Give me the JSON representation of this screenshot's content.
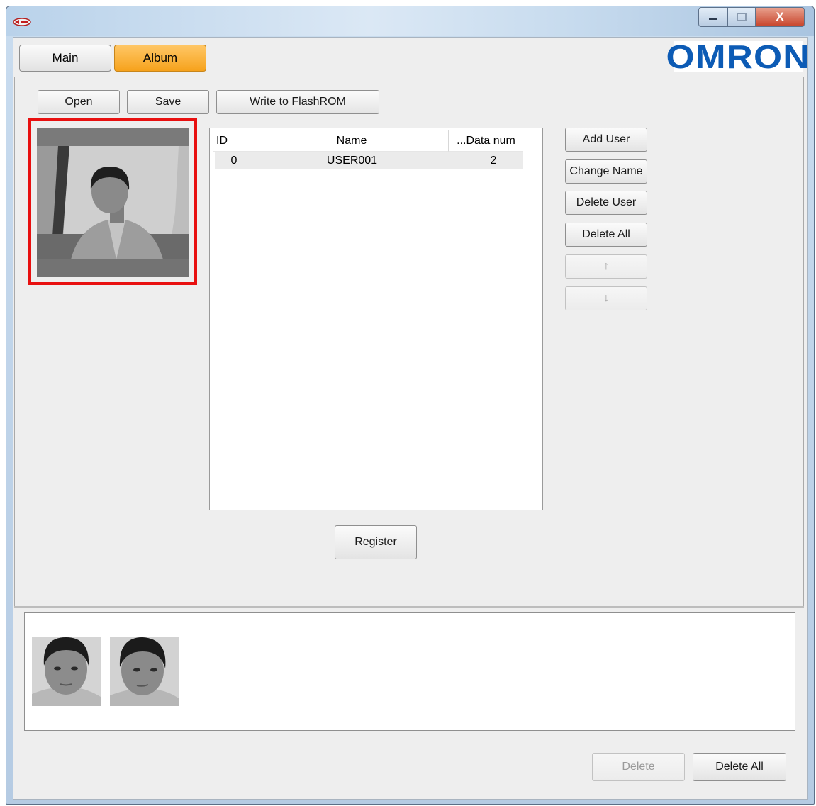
{
  "window": {
    "close_glyph": "X"
  },
  "tabs": [
    {
      "label": "Main"
    },
    {
      "label": "Album"
    }
  ],
  "logo_text": "OMRON",
  "toolbar": {
    "open_label": "Open",
    "save_label": "Save",
    "write_label": "Write to FlashROM"
  },
  "user_table": {
    "columns": [
      "ID",
      "Name",
      "...Data num"
    ],
    "rows": [
      {
        "id": "0",
        "name": "USER001",
        "data_num": "2"
      }
    ]
  },
  "user_actions": {
    "add_user": "Add User",
    "change_name": "Change Name",
    "delete_user": "Delete User",
    "delete_all": "Delete All",
    "move_up": "↑",
    "move_down": "↓"
  },
  "register_label": "Register",
  "bottom_actions": {
    "delete": "Delete",
    "delete_all": "Delete All"
  },
  "colors": {
    "album_tab": "#f6a21c",
    "highlight": "#e81010",
    "logo": "#0c5bb5"
  },
  "icons": [
    "app-icon",
    "minimize-icon",
    "maximize-icon",
    "close-icon",
    "arrow-up-icon",
    "arrow-down-icon"
  ]
}
